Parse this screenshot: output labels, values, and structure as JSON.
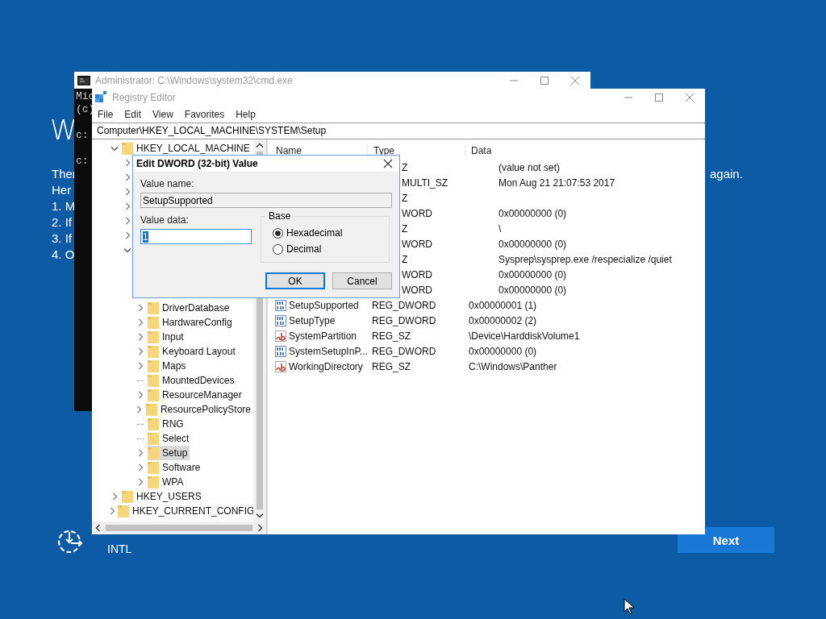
{
  "background": {
    "heading": "W",
    "lines": [
      "Ther",
      "Her",
      "1. M",
      "2. If",
      "3. If",
      "4. O"
    ],
    "right_text": "again.",
    "keyboard": "INTL",
    "next_button": "Next"
  },
  "cmd_window": {
    "title": "Administrator: C:\\Windows\\system32\\cmd.exe",
    "lines": [
      "Mic",
      "(c)",
      "c:",
      "c:"
    ]
  },
  "registry": {
    "title": "Registry Editor",
    "menu": [
      "File",
      "Edit",
      "View",
      "Favorites",
      "Help"
    ],
    "address": "Computer\\HKEY_LOCAL_MACHINE\\SYSTEM\\Setup",
    "tree": [
      {
        "label": "HKEY_LOCAL_MACHINE",
        "kind": "branch",
        "expanded": true,
        "selected": false,
        "children": [
          {
            "kind": "branch",
            "expanded": false
          },
          {
            "kind": "branch",
            "expanded": false
          },
          {
            "kind": "branch",
            "expanded": false
          },
          {
            "kind": "branch",
            "expanded": false
          },
          {
            "kind": "branch",
            "expanded": false
          },
          {
            "kind": "branch",
            "expanded": false
          },
          {
            "kind": "branch",
            "expanded": true,
            "children": [
              {
                "label": "DriverDatabase",
                "kind": "branch",
                "expanded": false,
                "selected": false
              },
              {
                "label": "HardwareConfig",
                "kind": "branch",
                "expanded": false,
                "selected": false
              },
              {
                "label": "Input",
                "kind": "branch",
                "expanded": false,
                "selected": false
              },
              {
                "label": "Keyboard Layout",
                "kind": "branch",
                "expanded": false,
                "selected": false
              },
              {
                "label": "Maps",
                "kind": "branch",
                "expanded": false,
                "selected": false
              },
              {
                "label": "MountedDevices",
                "kind": "leaf",
                "selected": false
              },
              {
                "label": "ResourceManager",
                "kind": "branch",
                "expanded": false,
                "selected": false
              },
              {
                "label": "ResourcePolicyStore",
                "kind": "branch",
                "expanded": false,
                "selected": false
              },
              {
                "label": "RNG",
                "kind": "leaf",
                "selected": false
              },
              {
                "label": "Select",
                "kind": "leaf",
                "selected": false
              },
              {
                "label": "Setup",
                "kind": "branch",
                "expanded": false,
                "selected": true
              },
              {
                "label": "Software",
                "kind": "branch",
                "expanded": false,
                "selected": false
              },
              {
                "label": "WPA",
                "kind": "branch",
                "expanded": false,
                "selected": false
              }
            ]
          }
        ]
      },
      {
        "label": "HKEY_USERS",
        "kind": "branch",
        "expanded": false,
        "selected": false
      },
      {
        "label": "HKEY_CURRENT_CONFIG",
        "kind": "branch",
        "expanded": false,
        "selected": false
      }
    ],
    "columns": [
      "Name",
      "Type",
      "Data"
    ],
    "values": [
      {
        "type": "Z",
        "data": "(value not set)"
      },
      {
        "type": "MULTI_SZ",
        "data": "Mon Aug 21 21:07:53 2017"
      },
      {
        "type": "Z"
      },
      {
        "type": "WORD",
        "data": "0x00000000 (0)"
      },
      {
        "type": "Z",
        "data": "\\"
      },
      {
        "type": "WORD",
        "data": "0x00000000 (0)"
      },
      {
        "type": "Z",
        "data": "Sysprep\\sysprep.exe /respecialize /quiet"
      },
      {
        "type": "WORD",
        "data": "0x00000000 (0)"
      },
      {
        "type": "WORD",
        "data": "0x00000000 (0)"
      },
      {
        "name": "SetupSupported",
        "kind": "dword",
        "type": "REG_DWORD",
        "data": "0x00000001 (1)"
      },
      {
        "name": "SetupType",
        "kind": "dword",
        "type": "REG_DWORD",
        "data": "0x00000002 (2)"
      },
      {
        "name": "SystemPartition",
        "kind": "sz",
        "type": "REG_SZ",
        "data": "\\Device\\HarddiskVolume1"
      },
      {
        "name": "SystemSetupInP...",
        "kind": "dword",
        "type": "REG_DWORD",
        "data": "0x00000000 (0)"
      },
      {
        "name": "WorkingDirectory",
        "kind": "sz",
        "type": "REG_SZ",
        "data": "C:\\Windows\\Panther"
      }
    ]
  },
  "dialog": {
    "title": "Edit DWORD (32-bit) Value",
    "value_name_label": "Value name:",
    "value_name": "SetupSupported",
    "value_data_label": "Value data:",
    "value_data": "1",
    "text_selected": true,
    "base_label": "Base",
    "radios": [
      {
        "label": "Hexadecimal",
        "selected": true
      },
      {
        "label": "Decimal",
        "selected": false
      }
    ],
    "buttons": [
      {
        "label": "OK",
        "default": true
      },
      {
        "label": "Cancel",
        "default": false
      }
    ]
  }
}
